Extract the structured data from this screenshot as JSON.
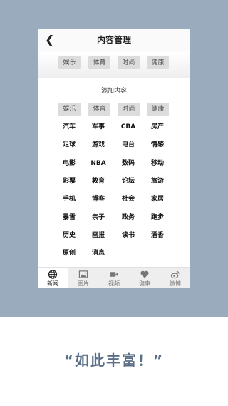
{
  "header": {
    "title": "内容管理",
    "back_icon": "chevron-left-icon"
  },
  "selected_tags": [
    "娱乐",
    "体育",
    "时尚",
    "健康"
  ],
  "add_section": {
    "label": "添加内容",
    "header_tags": [
      "娱乐",
      "体育",
      "时尚",
      "健康"
    ],
    "categories": [
      [
        "汽车",
        "军事",
        "CBA",
        "房产"
      ],
      [
        "足球",
        "游戏",
        "电台",
        "情感"
      ],
      [
        "电影",
        "NBA",
        "数码",
        "移动"
      ],
      [
        "彩票",
        "教育",
        "论坛",
        "旅游"
      ],
      [
        "手机",
        "博客",
        "社会",
        "家居"
      ],
      [
        "暴雪",
        "亲子",
        "政务",
        "跑步"
      ],
      [
        "历史",
        "画报",
        "读书",
        "酒香"
      ],
      [
        "原创",
        "消息"
      ]
    ]
  },
  "tabbar": {
    "tabs": [
      {
        "label": "新闻",
        "icon": "globe-icon",
        "active": true
      },
      {
        "label": "图片",
        "icon": "picture-icon",
        "active": false
      },
      {
        "label": "视频",
        "icon": "video-camera-icon",
        "active": false
      },
      {
        "label": "健康",
        "icon": "heart-icon",
        "active": false
      },
      {
        "label": "微博",
        "icon": "weibo-icon",
        "active": false
      }
    ]
  },
  "slogan": "“如此丰富！”",
  "colors": {
    "background_blue": "#9aabbd",
    "slogan": "#5a6f86",
    "tag_bg": "#dcdcdc"
  }
}
